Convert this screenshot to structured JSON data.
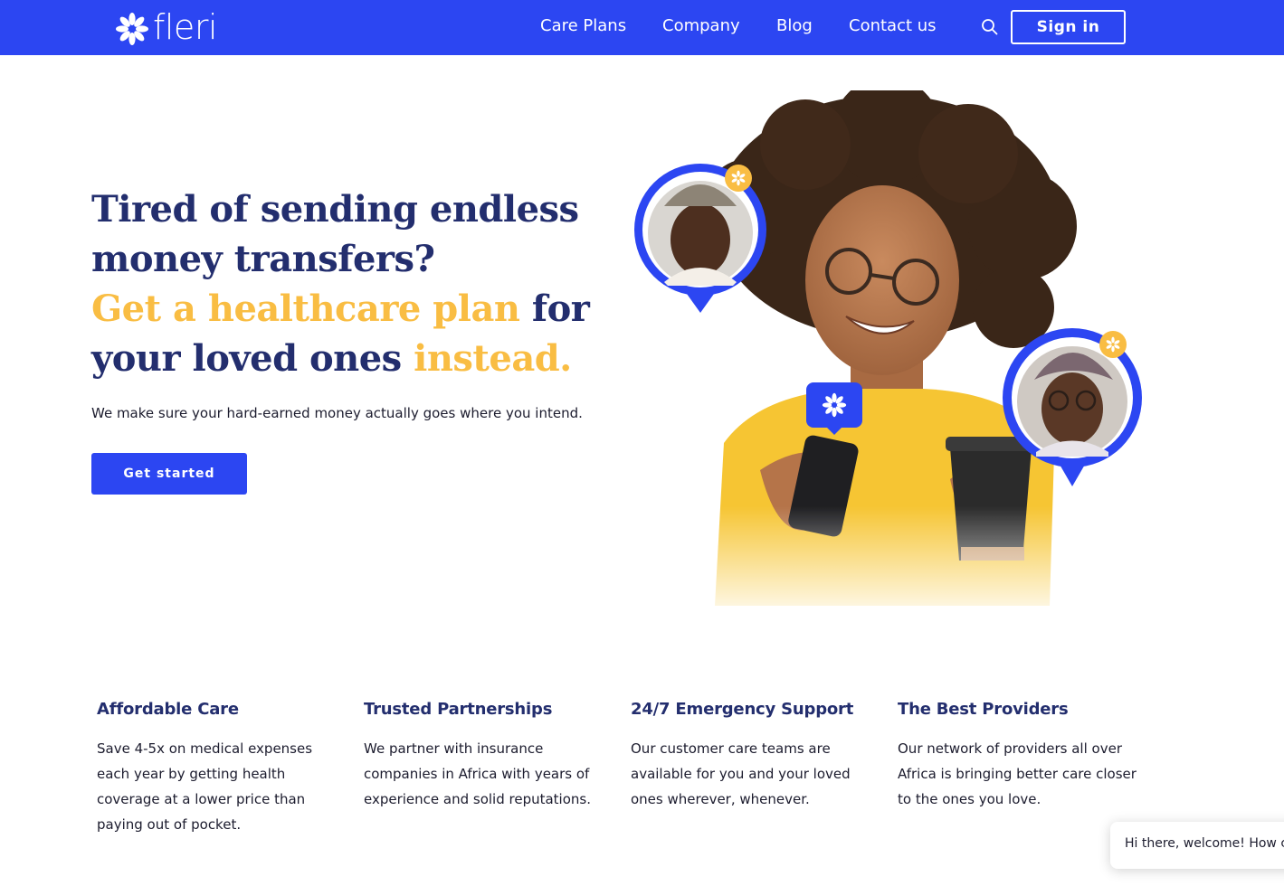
{
  "header": {
    "logo_text": "fleri",
    "nav": [
      "Care Plans",
      "Company",
      "Blog",
      "Contact us"
    ],
    "sign_in_label": "Sign in"
  },
  "hero": {
    "headline_line1": "Tired of sending endless money transfers?",
    "headline_accent1": "Get a healthcare plan",
    "headline_plain2": " for your loved ones ",
    "headline_accent2": "instead.",
    "subtext": "We make sure your hard-earned money actually goes where you intend.",
    "cta_label": "Get started"
  },
  "features": [
    {
      "title": "Affordable Care",
      "text": "Save 4-5x on medical expenses each year by getting health coverage at a lower price than paying out of pocket."
    },
    {
      "title": "Trusted Partnerships",
      "text": "We partner with insurance companies in Africa with years of experience and solid reputations."
    },
    {
      "title": "24/7 Emergency Support",
      "text": "Our customer care teams are available for you and your loved ones wherever, whenever."
    },
    {
      "title": "The Best Providers",
      "text": "Our network of providers all over Africa is bringing better care closer to the ones you love."
    }
  ],
  "chat": {
    "message": "Hi there, welcome! How c"
  },
  "colors": {
    "brand_blue": "#2c46f2",
    "navy": "#232e6e",
    "accent_yellow": "#f9bd43"
  },
  "icons": [
    "fleri-flower-logo-icon",
    "search-icon",
    "flower-badge-icon"
  ]
}
